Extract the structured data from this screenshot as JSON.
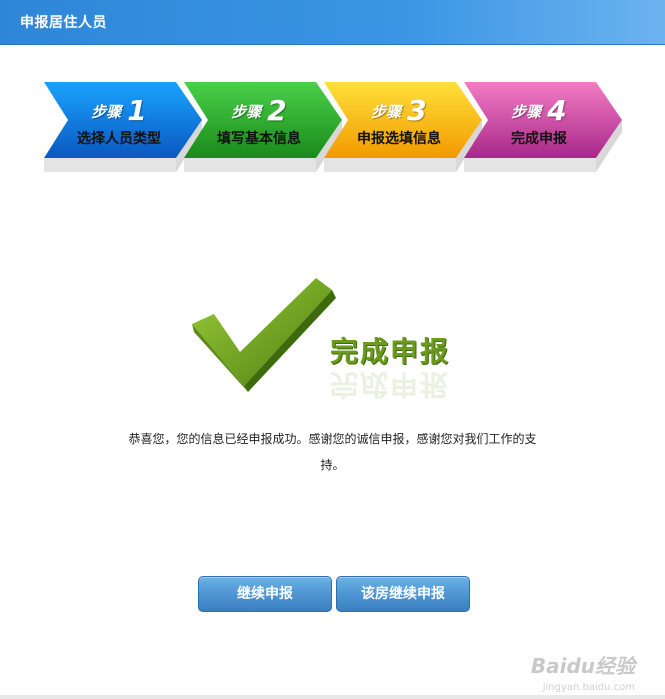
{
  "header": {
    "title": "申报居住人员"
  },
  "steps": [
    {
      "title": "步骤",
      "num": "1",
      "label": "选择人员类型",
      "color_top": "#0a8ff0",
      "color_bottom": "#0a5bbf"
    },
    {
      "title": "步骤",
      "num": "2",
      "label": "填写基本信息",
      "color_top": "#3cc43c",
      "color_bottom": "#1a8f1a"
    },
    {
      "title": "步骤",
      "num": "3",
      "label": "申报选填信息",
      "color_top": "#ffd21c",
      "color_bottom": "#f0a000"
    },
    {
      "title": "步骤",
      "num": "4",
      "label": "完成申报",
      "color_top": "#f06ab8",
      "color_bottom": "#b02a88"
    }
  ],
  "result": {
    "title": "完成申报",
    "message": "恭喜您，您的信息已经申报成功。感谢您的诚信申报，感谢您对我们工作的支持。"
  },
  "buttons": {
    "continue_label": "继续申报",
    "same_house_label": "该房继续申报"
  },
  "watermark": {
    "logo": "Baidu经验",
    "url": "jingyan.baidu.com"
  },
  "colors": {
    "header": "#3a95e4",
    "check": "#7fb02a",
    "button": "#4e95d2"
  }
}
